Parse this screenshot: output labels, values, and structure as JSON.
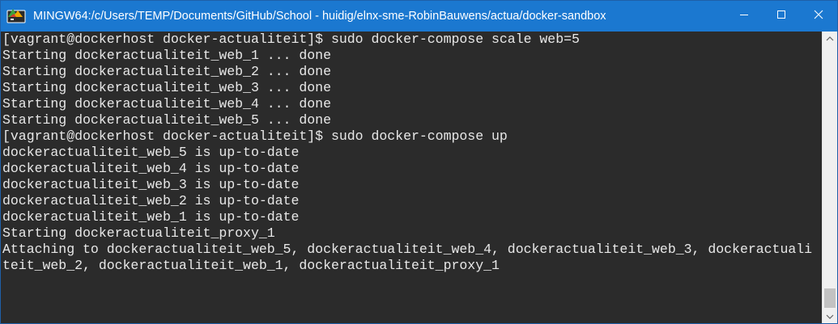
{
  "window": {
    "title": "MINGW64:/c/Users/TEMP/Documents/GitHub/School - huidig/elnx-sme-RobinBauwens/actua/docker-sandbox",
    "icon": "mingw-terminal-icon",
    "controls": {
      "minimize_icon": "minimize-icon",
      "maximize_icon": "maximize-icon",
      "close_icon": "close-icon"
    },
    "colors": {
      "titlebar": "#1b78d0",
      "console_bg": "#2b2b2b",
      "console_fg": "#e8e8e8"
    }
  },
  "console": {
    "lines": [
      "[vagrant@dockerhost docker-actualiteit]$ sudo docker-compose scale web=5",
      "Starting dockeractualiteit_web_1 ... done",
      "Starting dockeractualiteit_web_2 ... done",
      "Starting dockeractualiteit_web_3 ... done",
      "Starting dockeractualiteit_web_4 ... done",
      "Starting dockeractualiteit_web_5 ... done",
      "[vagrant@dockerhost docker-actualiteit]$ sudo docker-compose up",
      "dockeractualiteit_web_5 is up-to-date",
      "dockeractualiteit_web_4 is up-to-date",
      "dockeractualiteit_web_3 is up-to-date",
      "dockeractualiteit_web_2 is up-to-date",
      "dockeractualiteit_web_1 is up-to-date",
      "Starting dockeractualiteit_proxy_1",
      "Attaching to dockeractualiteit_web_5, dockeractualiteit_web_4, dockeractualiteit_web_3, dockeractuali",
      "teit_web_2, dockeractualiteit_web_1, dockeractualiteit_proxy_1"
    ]
  },
  "scrollbar": {
    "up_icon": "scroll-up-arrow-icon",
    "down_icon": "scroll-down-arrow-icon"
  }
}
